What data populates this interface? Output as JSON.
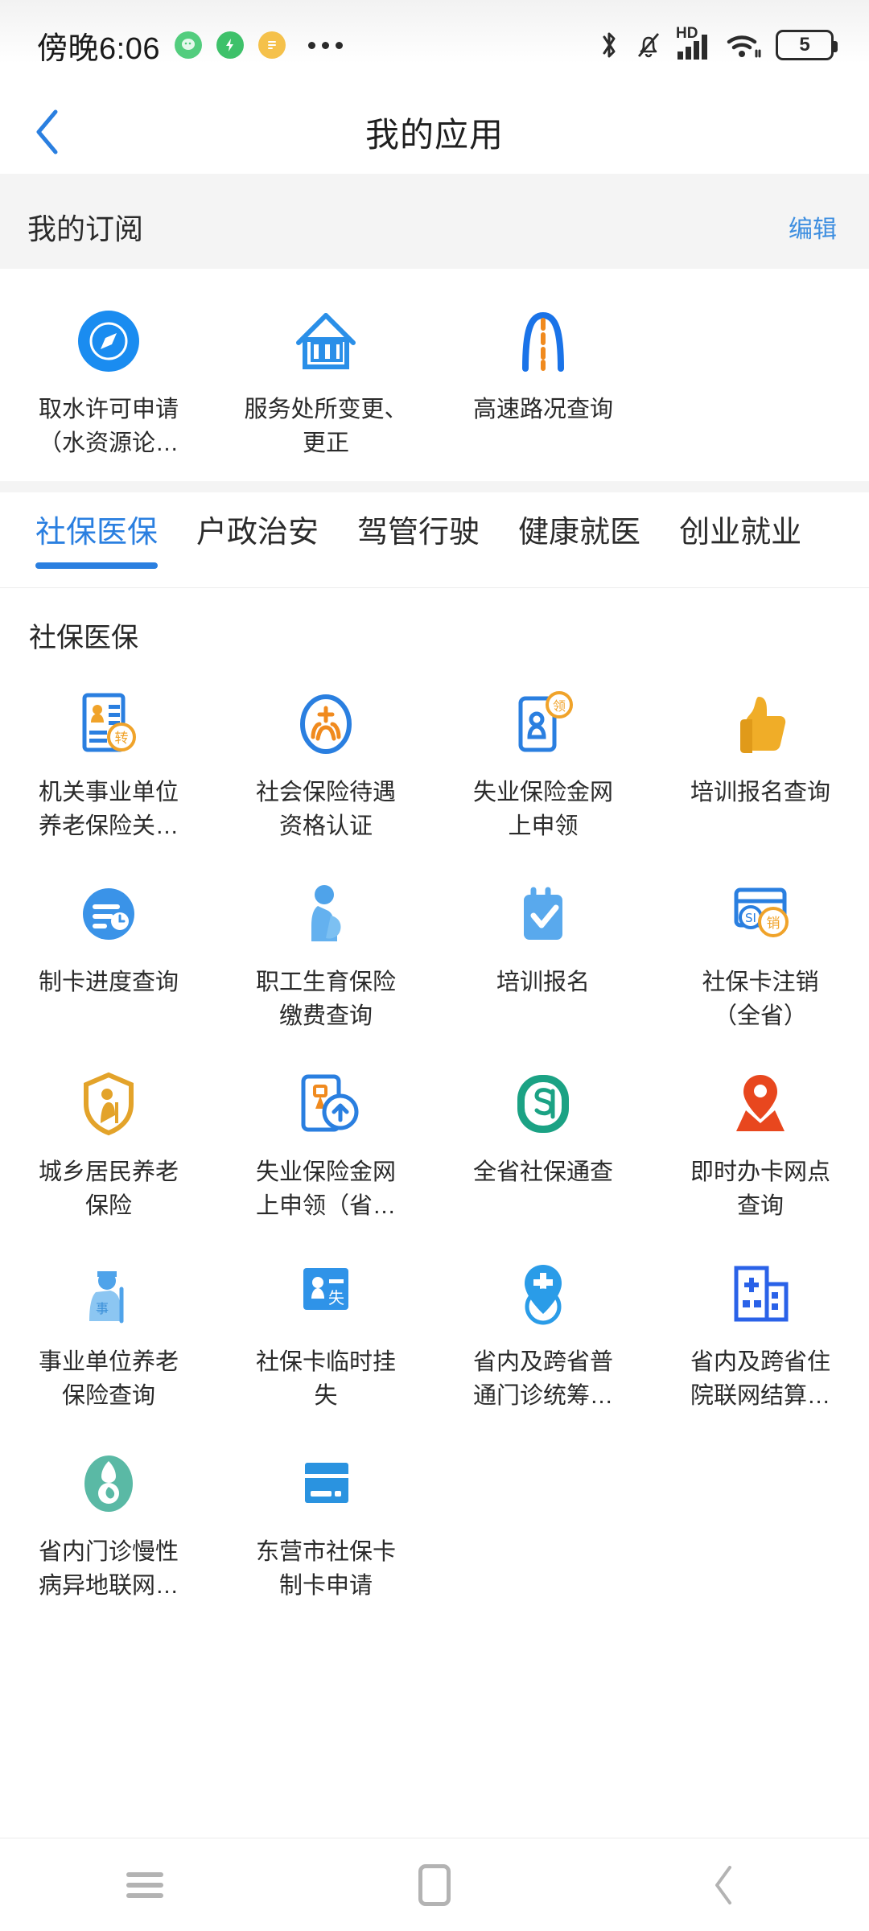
{
  "status_bar": {
    "time": "傍晚6:06",
    "left_icons": [
      "chat-badge-icon",
      "flash-badge-icon",
      "note-badge-icon",
      "more-dots-icon"
    ],
    "right_icons": [
      "bluetooth-icon",
      "bell-muted-icon",
      "hd-signal-icon",
      "wifi-icon",
      "battery-icon"
    ],
    "hd_label": "HD",
    "battery_level": "5"
  },
  "navbar": {
    "back_icon": "chevron-left-icon",
    "title": "我的应用"
  },
  "subscription": {
    "title": "我的订阅",
    "edit_label": "编辑",
    "items": [
      {
        "label": "取水许可申请（水资源论…",
        "icon": "compass-icon",
        "color": "#1a8cf0"
      },
      {
        "label": "服务处所变更、更正",
        "icon": "house-building-icon",
        "color": "#1a8cf0"
      },
      {
        "label": "高速路况查询",
        "icon": "highway-road-icon",
        "color": "#1a73e8"
      }
    ]
  },
  "tabs": [
    {
      "label": "社保医保",
      "active": true
    },
    {
      "label": "户政治安",
      "active": false
    },
    {
      "label": "驾管行驶",
      "active": false
    },
    {
      "label": "健康就医",
      "active": false
    },
    {
      "label": "创业就业",
      "active": false
    }
  ],
  "category_title": "社保医保",
  "apps": [
    {
      "label": "机关事业单位养老保险关…",
      "icon": "id-card-transfer-icon",
      "color": "#2a7fe0"
    },
    {
      "label": "社会保险待遇资格认证",
      "icon": "hands-cross-circle-icon",
      "color": "#2a7fe0"
    },
    {
      "label": "失业保险金网上申领",
      "icon": "phone-person-claim-icon",
      "color": "#2a7fe0"
    },
    {
      "label": "培训报名查询",
      "icon": "thumbs-up-icon",
      "color": "#f0a32a"
    },
    {
      "label": "制卡进度查询",
      "icon": "progress-clock-icon",
      "color": "#3a93e8"
    },
    {
      "label": "职工生育保险缴费查询",
      "icon": "pregnant-person-icon",
      "color": "#56a8ec"
    },
    {
      "label": "培训报名",
      "icon": "calendar-check-icon",
      "color": "#56a8ec"
    },
    {
      "label": "社保卡注销",
      "icon": "card-cancel-icon",
      "color": "#2a7fe0",
      "label2": "（全省）"
    },
    {
      "label": "城乡居民养老保险",
      "icon": "shield-elder-icon",
      "color": "#e3a32a"
    },
    {
      "label": "失业保险金网上申领（省…",
      "icon": "phone-upload-icon",
      "color": "#2a7fe0"
    },
    {
      "label": "全省社保通查",
      "icon": "si-logo-icon",
      "color": "#1ba284"
    },
    {
      "label": "即时办卡网点查询",
      "icon": "map-pin-icon",
      "color": "#e8471e"
    },
    {
      "label": "事业单位养老保险查询",
      "icon": "elder-person-icon",
      "color": "#56a8ec"
    },
    {
      "label": "社保卡临时挂失",
      "icon": "card-loss-icon",
      "color": "#2f93e8"
    },
    {
      "label": "省内及跨省普通门诊统筹…",
      "icon": "medical-pin-icon",
      "color": "#2a9ce8"
    },
    {
      "label": "省内及跨省住院联网结算…",
      "icon": "hospital-icon",
      "color": "#2a62e8"
    },
    {
      "label": "省内门诊慢性病异地联网…",
      "icon": "mortar-pestle-icon",
      "color": "#5ab9a5"
    },
    {
      "label": "东营市社保卡制卡申请",
      "icon": "bank-card-icon",
      "color": "#2a93e0"
    }
  ],
  "system_nav": {
    "recents_icon": "menu-icon",
    "home_icon": "home-square-icon",
    "back_icon": "chevron-left-icon"
  },
  "colors": {
    "accent": "#2a7fe0",
    "link": "#3d8ee0",
    "page_bg": "#ffffff",
    "section_bg": "#f4f4f4"
  }
}
